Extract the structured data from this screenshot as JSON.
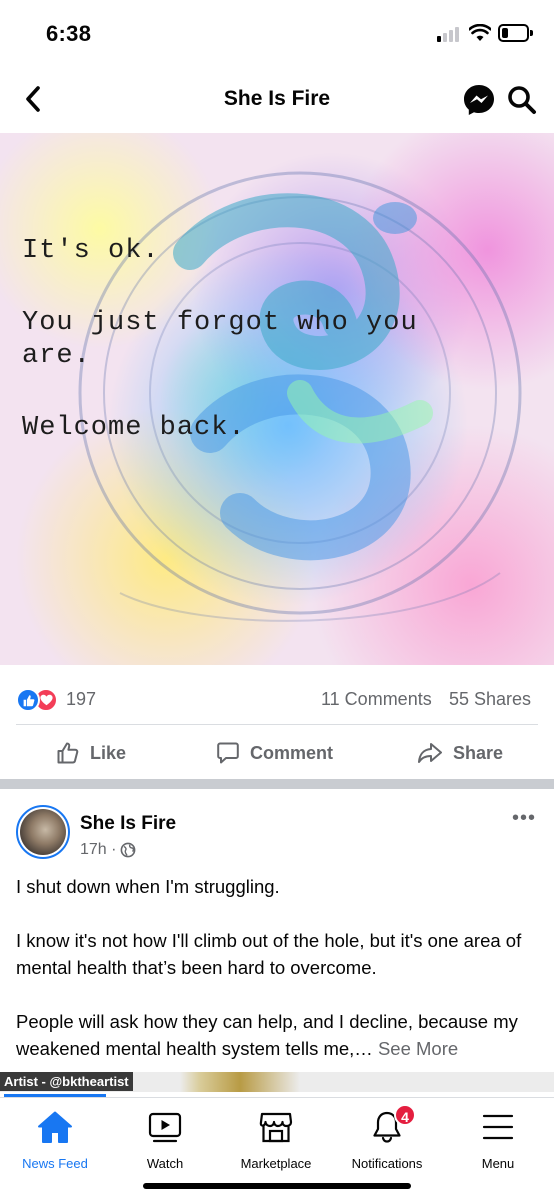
{
  "status_bar": {
    "time": "6:38"
  },
  "header": {
    "title": "She Is Fire"
  },
  "post1": {
    "image_text": {
      "line1": "It's ok.",
      "line2a": "You just forgot who you",
      "line2b": "are.",
      "line3": "Welcome back."
    },
    "reaction_count": "197",
    "comments": "11 Comments",
    "shares": "55 Shares",
    "actions": {
      "like": "Like",
      "comment": "Comment",
      "share": "Share"
    }
  },
  "post2": {
    "author": "She Is Fire",
    "time": "17h ·",
    "more": "•••",
    "paragraphs": [
      "I shut down when I'm struggling.",
      "I know it's not how I'll climb out of the hole, but it's one area of mental health that’s been hard to overcome.",
      "People will ask how they can help, and I decline, because my weakened mental health system tells me,…"
    ],
    "see_more": "See More",
    "artist_tag": "Artist - @bktheartist"
  },
  "bottom_nav": {
    "items": [
      {
        "label": "News Feed",
        "icon": "home-icon"
      },
      {
        "label": "Watch",
        "icon": "video-icon"
      },
      {
        "label": "Marketplace",
        "icon": "store-icon"
      },
      {
        "label": "Notifications",
        "icon": "bell-icon"
      },
      {
        "label": "Menu",
        "icon": "hamburger-icon"
      }
    ],
    "notification_badge": "4"
  },
  "colors": {
    "accent": "#1877f2",
    "love": "#f33e58",
    "badge": "#e41e3f",
    "secondary_text": "#65676b"
  }
}
